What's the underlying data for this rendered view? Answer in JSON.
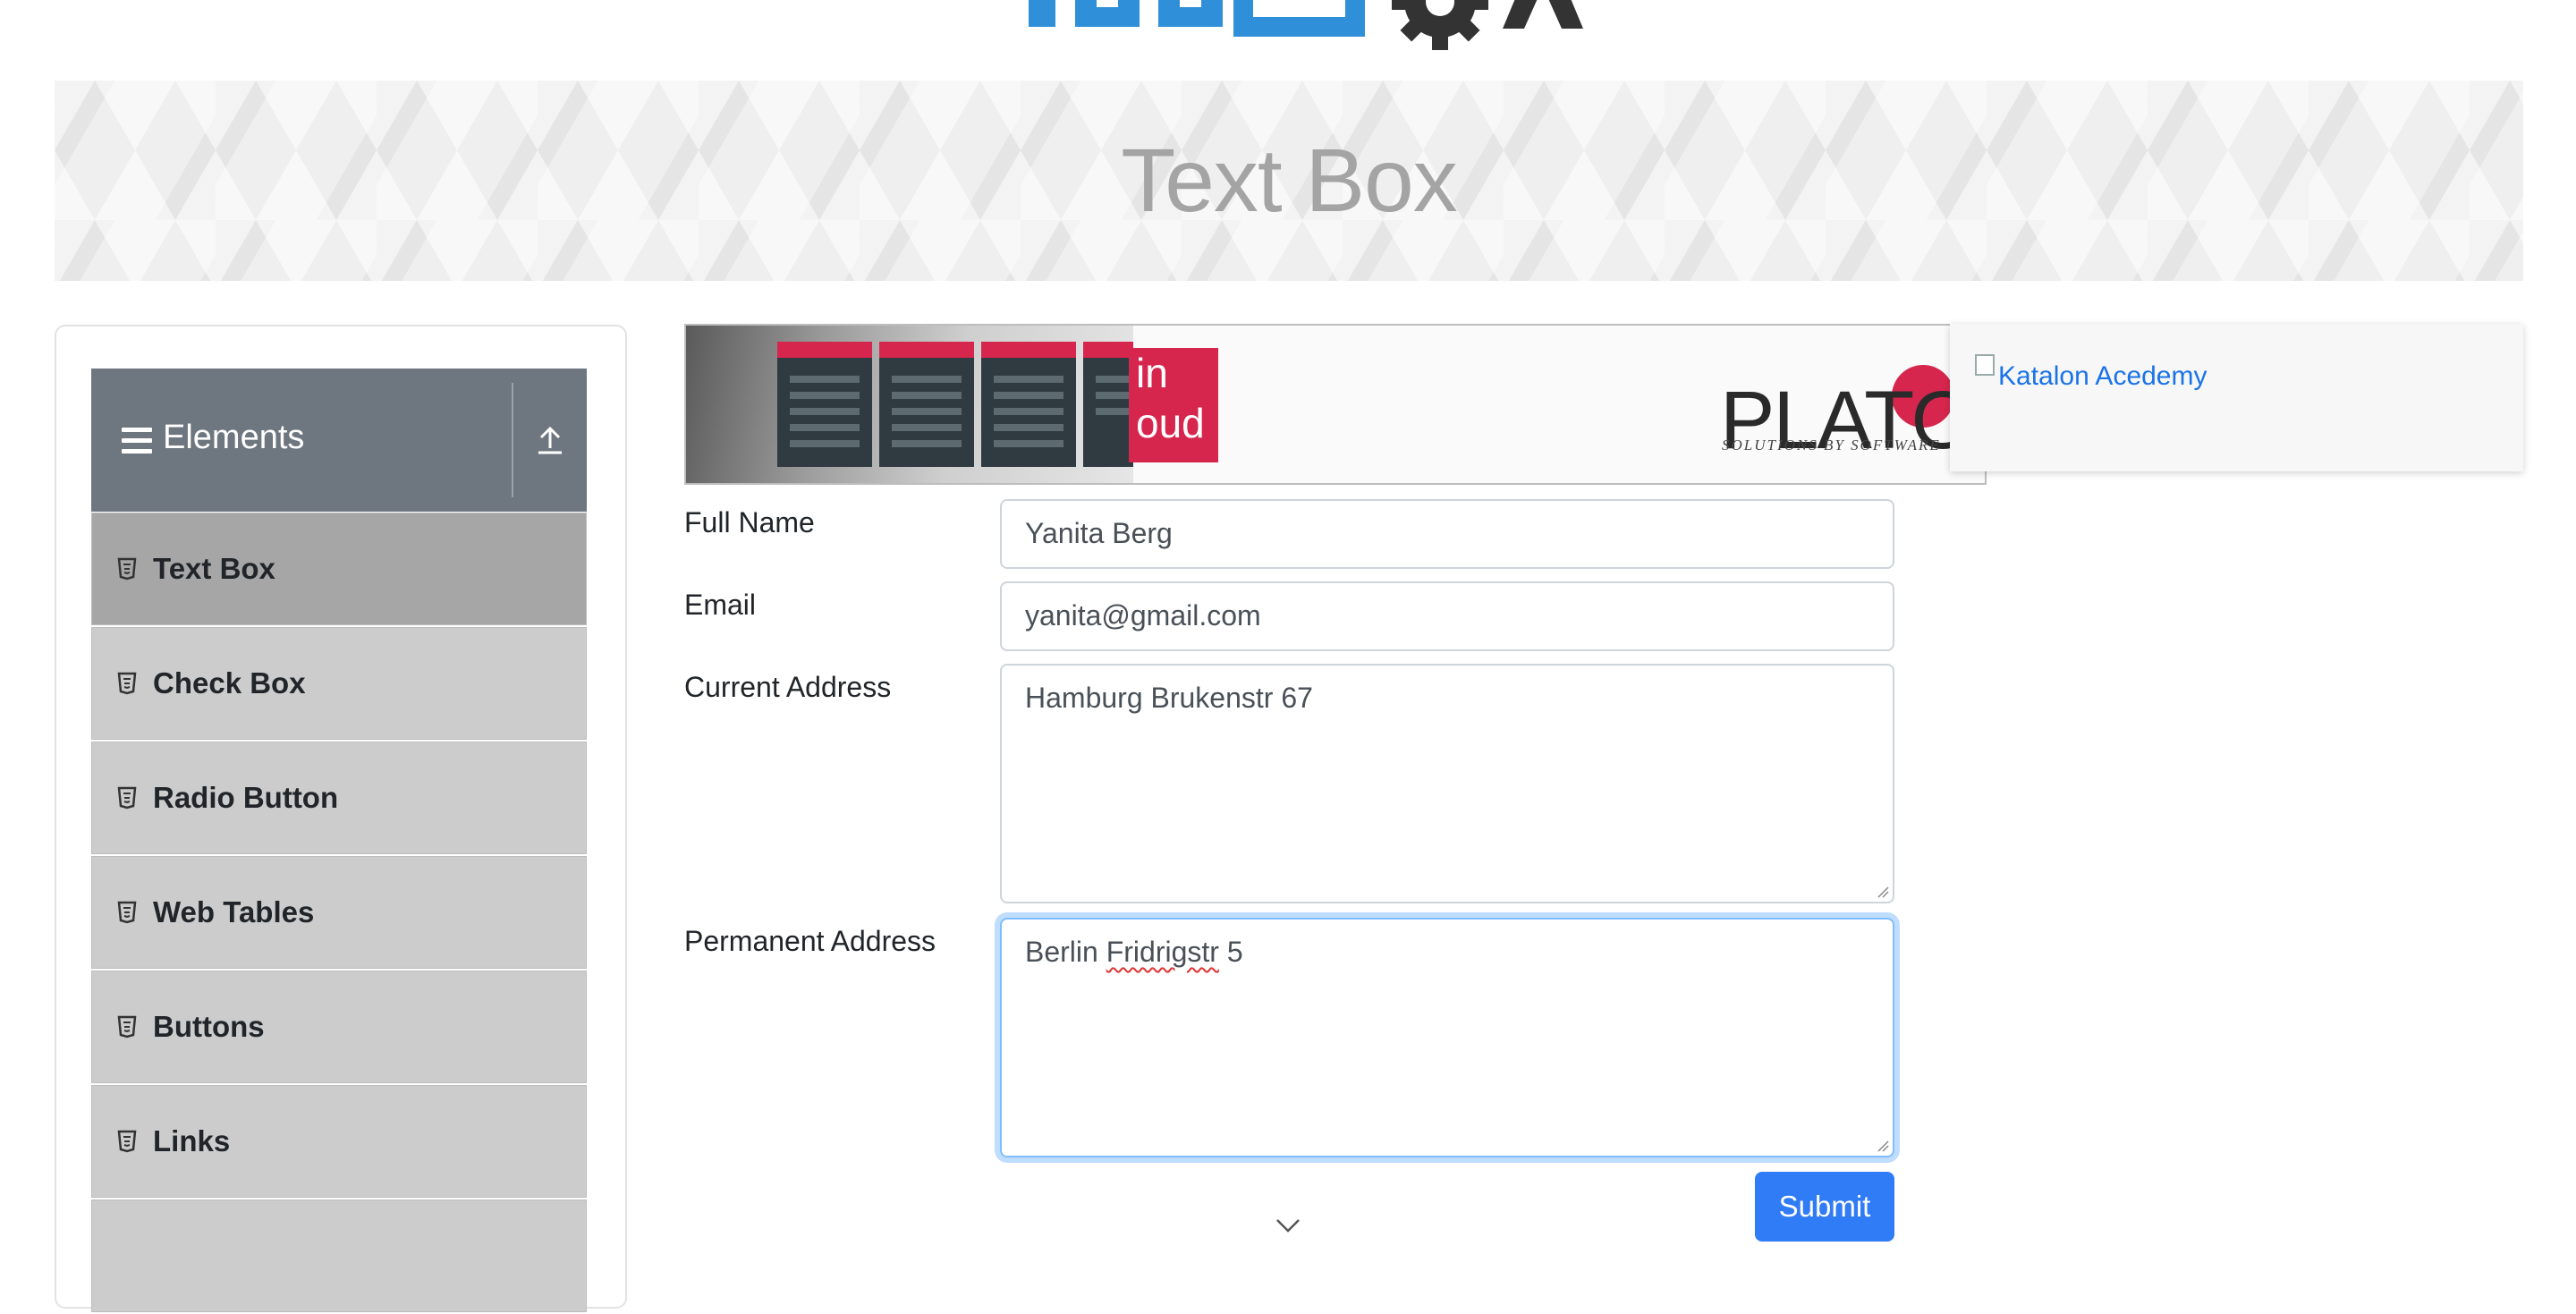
{
  "header": {
    "title": "Text Box"
  },
  "sidebar": {
    "group_title": "Elements",
    "items": [
      {
        "label": "Text Box",
        "active": true
      },
      {
        "label": "Check Box"
      },
      {
        "label": "Radio Button"
      },
      {
        "label": "Web Tables"
      },
      {
        "label": "Buttons"
      },
      {
        "label": "Links"
      }
    ]
  },
  "ads": {
    "main_ad": {
      "brand": "PLATO",
      "tagline": "SOLUTIONS BY SOFTWARE",
      "partial_text": "in\noud"
    },
    "katalon": {
      "alt_text": "Katalon Acedemy"
    }
  },
  "form": {
    "full_name": {
      "label": "Full Name",
      "value": "Yanita Berg"
    },
    "email": {
      "label": "Email",
      "value": "yanita@gmail.com"
    },
    "current_address": {
      "label": "Current Address",
      "value": "Hamburg Brukenstr 67"
    },
    "permanent_address": {
      "label": "Permanent Address",
      "value_prefix": "Berlin ",
      "value_misspelled": "Fridrigstr",
      "value_suffix": " 5"
    },
    "submit_label": "Submit"
  },
  "colors": {
    "accent": "#2f7cf6",
    "sidebar_header": "#6e7780",
    "active_item": "#a6a6a6",
    "menu_item": "#cccccc"
  }
}
